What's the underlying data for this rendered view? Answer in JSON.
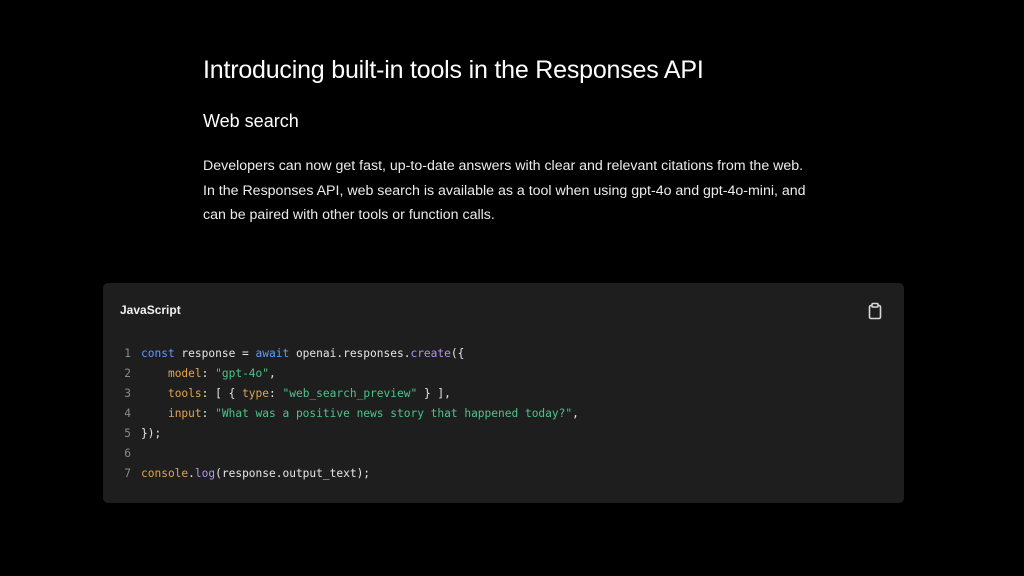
{
  "article": {
    "title": "Introducing built-in tools in the Responses API",
    "subtitle": "Web search",
    "paragraph": "Developers can now get fast, up-to-date answers with clear and relevant citations from the web. In the Responses API, web search is available as a tool when using gpt-4o and gpt-4o-mini, and can be paired with other tools or function calls."
  },
  "code": {
    "language": "JavaScript",
    "copy_icon": "clipboard-icon",
    "lines": [
      {
        "n": "1",
        "tokens": [
          {
            "t": "const",
            "c": "kw"
          },
          {
            "t": " response = ",
            "c": "plain"
          },
          {
            "t": "await",
            "c": "kw"
          },
          {
            "t": " openai.responses.",
            "c": "plain"
          },
          {
            "t": "create",
            "c": "fn"
          },
          {
            "t": "({",
            "c": "plain"
          }
        ]
      },
      {
        "n": "2",
        "tokens": [
          {
            "t": "    ",
            "c": "plain"
          },
          {
            "t": "model",
            "c": "prop"
          },
          {
            "t": ": ",
            "c": "plain"
          },
          {
            "t": "\"gpt-4o\"",
            "c": "str"
          },
          {
            "t": ",",
            "c": "plain"
          }
        ]
      },
      {
        "n": "3",
        "tokens": [
          {
            "t": "    ",
            "c": "plain"
          },
          {
            "t": "tools",
            "c": "prop"
          },
          {
            "t": ": [ { ",
            "c": "plain"
          },
          {
            "t": "type",
            "c": "prop"
          },
          {
            "t": ": ",
            "c": "plain"
          },
          {
            "t": "\"web_search_preview\"",
            "c": "str"
          },
          {
            "t": " } ],",
            "c": "plain"
          }
        ]
      },
      {
        "n": "4",
        "tokens": [
          {
            "t": "    ",
            "c": "plain"
          },
          {
            "t": "input",
            "c": "prop"
          },
          {
            "t": ": ",
            "c": "plain"
          },
          {
            "t": "\"What was a positive news story that happened today?\"",
            "c": "str"
          },
          {
            "t": ",",
            "c": "plain"
          }
        ]
      },
      {
        "n": "5",
        "tokens": [
          {
            "t": "});",
            "c": "plain"
          }
        ]
      },
      {
        "n": "6",
        "tokens": []
      },
      {
        "n": "7",
        "tokens": [
          {
            "t": "console",
            "c": "prop"
          },
          {
            "t": ".",
            "c": "plain"
          },
          {
            "t": "log",
            "c": "fn"
          },
          {
            "t": "(response.output_text);",
            "c": "plain"
          }
        ]
      }
    ]
  },
  "colors": {
    "background": "#000000",
    "code_background": "#1e1e1e",
    "keyword": "#5c9cff",
    "function": "#b48ff5",
    "property": "#e5a24c",
    "string": "#4cc38a"
  }
}
